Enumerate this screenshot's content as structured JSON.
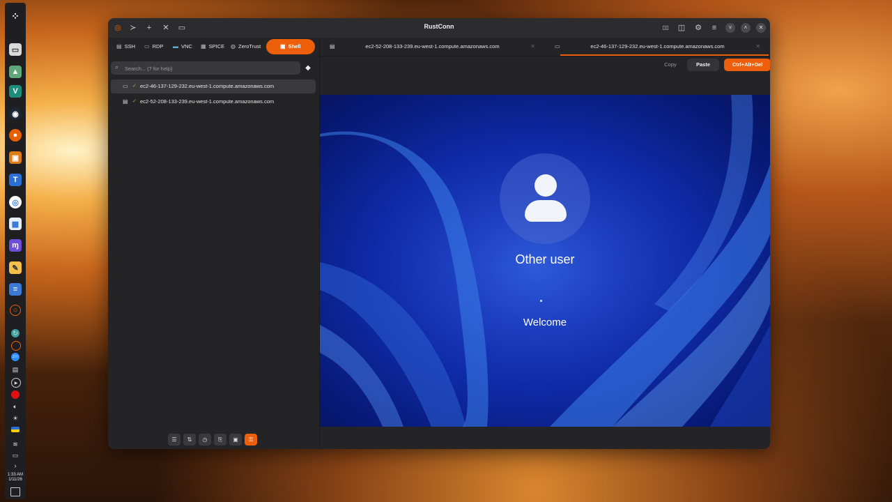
{
  "window": {
    "title": "RustConn"
  },
  "protocol_tabs": [
    {
      "label": "SSH",
      "icon": "terminal-icon"
    },
    {
      "label": "RDP",
      "icon": "monitor-icon"
    },
    {
      "label": "VNC",
      "icon": "display-icon"
    },
    {
      "label": "SPICE",
      "icon": "spice-icon"
    },
    {
      "label": "ZeroTrust",
      "icon": "globe-icon"
    },
    {
      "label": "Shell",
      "icon": "shell-icon",
      "active": true
    }
  ],
  "search": {
    "placeholder": "Search... (? for help)"
  },
  "connections": [
    {
      "label": "ec2-46-137-129-232.eu-west-1.compute.amazonaws.com",
      "type": "rdp",
      "selected": true
    },
    {
      "label": "ec2-52-208-133-239.eu-west-1.compute.amazonaws.com",
      "type": "ssh",
      "selected": false
    }
  ],
  "session_tabs": [
    {
      "label": "ec2-52-208-133-239.eu-west-1.compute.amazonaws.com",
      "active": false
    },
    {
      "label": "ec2-46-137-129-232.eu-west-1.compute.amazonaws.com",
      "active": true
    }
  ],
  "actions": {
    "copy": "Copy",
    "paste": "Paste",
    "ctrl_alt_del": "Ctrl+Alt+Del"
  },
  "remote_screen": {
    "user_name": "Other user",
    "status": "Welcome"
  },
  "taskbar": {
    "time": "1:33 AM",
    "date": "1/11/26"
  },
  "colors": {
    "accent": "#ed5f0b",
    "window_bg": "#242426",
    "remote_bg": "#1c3ec0"
  }
}
